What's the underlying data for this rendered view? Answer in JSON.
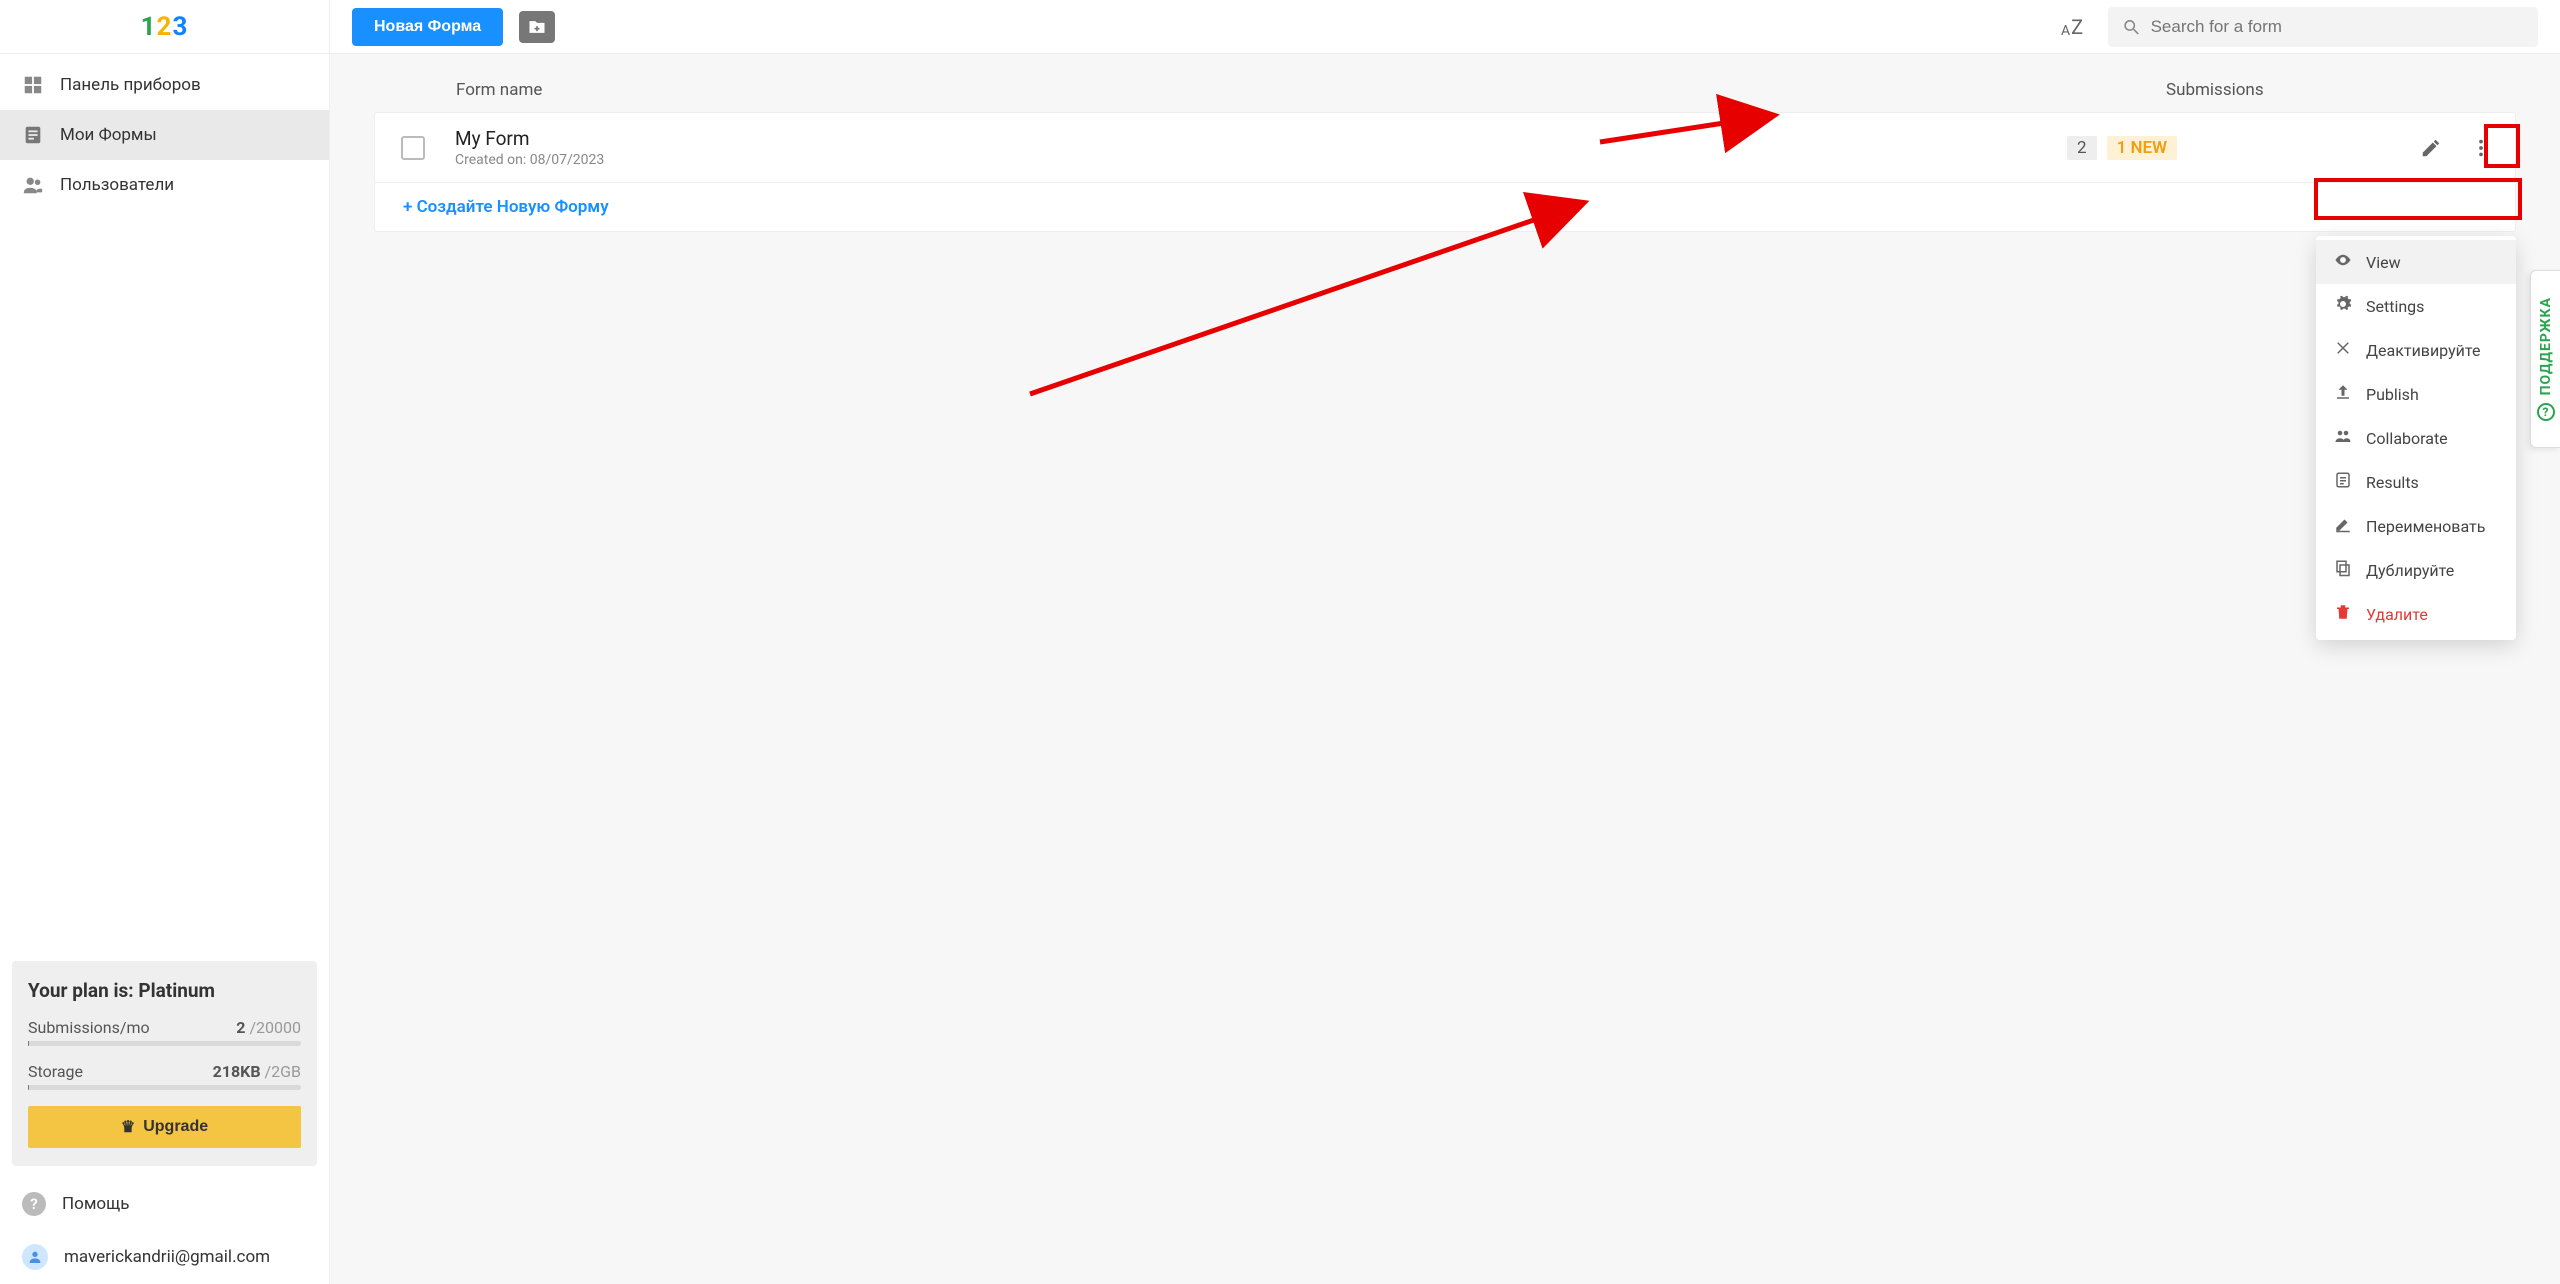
{
  "header": {
    "new_form_label": "Новая Форма",
    "search_placeholder": "Search for a form"
  },
  "sidebar": {
    "items": [
      {
        "label": "Панель приборов"
      },
      {
        "label": "Мои Формы"
      },
      {
        "label": "Пользователи"
      }
    ],
    "plan": {
      "title": "Your plan is: Platinum",
      "submissions_label": "Submissions/mo",
      "submissions_used": "2",
      "submissions_limit": "/20000",
      "storage_label": "Storage",
      "storage_used": "218KB",
      "storage_limit": "/2GB",
      "upgrade_label": "Upgrade"
    },
    "help_label": "Помощь",
    "user_email": "maverickandrii@gmail.com"
  },
  "list": {
    "col_name": "Form name",
    "col_submissions": "Submissions",
    "rows": [
      {
        "title": "My Form",
        "created": "Created on: 08/07/2023",
        "count": "2",
        "new_badge": "1 NEW"
      }
    ],
    "create_label": "+ Создайте Новую Форму"
  },
  "menu": {
    "items": [
      {
        "label": "View",
        "icon": "eye",
        "highlight": true
      },
      {
        "label": "Settings",
        "icon": "gear"
      },
      {
        "label": "Деактивируйте",
        "icon": "cross"
      },
      {
        "label": "Publish",
        "icon": "publish"
      },
      {
        "label": "Collaborate",
        "icon": "people"
      },
      {
        "label": "Results",
        "icon": "results"
      },
      {
        "label": "Переименовать",
        "icon": "rename"
      },
      {
        "label": "Дублируйте",
        "icon": "copy"
      },
      {
        "label": "Удалите",
        "icon": "trash",
        "danger": true
      }
    ]
  },
  "support_label": "ПОДДЕРЖКА"
}
